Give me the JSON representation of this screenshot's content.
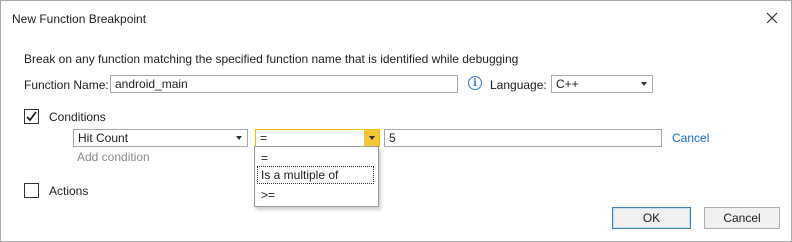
{
  "window": {
    "title": "New Function Breakpoint"
  },
  "description": "Break on any function matching the specified function name that is identified while debugging",
  "function_name": {
    "label": "Function Name:",
    "value": "android_main"
  },
  "language": {
    "label": "Language:",
    "value": "C++"
  },
  "conditions": {
    "label": "Conditions",
    "checked": true,
    "condition_type": "Hit Count",
    "operator": "=",
    "value": "5",
    "cancel_label": "Cancel",
    "add_condition_label": "Add condition",
    "operator_options": [
      "=",
      "Is a multiple of",
      ">="
    ]
  },
  "actions": {
    "label": "Actions",
    "checked": false
  },
  "buttons": {
    "ok": "OK",
    "cancel": "Cancel"
  },
  "icons": {
    "close": "close-icon",
    "info": "info-icon",
    "check": "checkmark-icon"
  },
  "colors": {
    "accent": "#1a6ac8",
    "dropdown_highlight": "#f5c53c",
    "info": "#2f7bd6"
  }
}
